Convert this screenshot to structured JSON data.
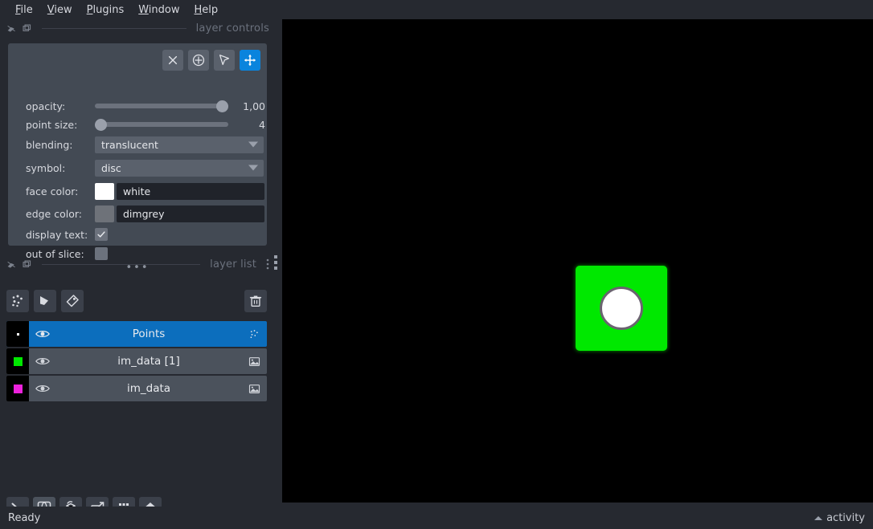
{
  "menubar": {
    "items": [
      {
        "mnemonic": "F",
        "rest": "ile"
      },
      {
        "mnemonic": "V",
        "rest": "iew"
      },
      {
        "mnemonic": "P",
        "rest": "lugins"
      },
      {
        "mnemonic": "W",
        "rest": "indow"
      },
      {
        "mnemonic": "H",
        "rest": "elp"
      }
    ],
    "labels": [
      "File",
      "View",
      "Plugins",
      "Window",
      "Help"
    ]
  },
  "layer_controls": {
    "dock_title": "layer controls",
    "tools": [
      {
        "name": "delete-selected-points",
        "icon": "close-icon",
        "active": false
      },
      {
        "name": "add-points",
        "icon": "add-circle-icon",
        "active": false
      },
      {
        "name": "select-points",
        "icon": "cursor-arrow-icon",
        "active": false
      },
      {
        "name": "pan-zoom",
        "icon": "move-arrows-icon",
        "active": true
      }
    ],
    "opacity": {
      "label": "opacity:",
      "value": "1,00",
      "fraction": 1.0
    },
    "point_size": {
      "label": "point size:",
      "value": "4",
      "fraction": 0.03
    },
    "blending": {
      "label": "blending:",
      "value": "translucent"
    },
    "symbol": {
      "label": "symbol:",
      "value": "disc"
    },
    "face_color": {
      "label": "face color:",
      "value": "white",
      "swatch": "#ffffff"
    },
    "edge_color": {
      "label": "edge color:",
      "value": "dimgrey",
      "swatch": "#6e7279"
    },
    "display_text": {
      "label": "display text:",
      "checked": true
    },
    "out_of_slice": {
      "label": "out of slice:",
      "checked": false
    }
  },
  "layer_list": {
    "dock_title": "layer list",
    "buttons": [
      {
        "name": "new-points-layer",
        "icon": "points-icon"
      },
      {
        "name": "new-shapes-layer",
        "icon": "shapes-icon"
      },
      {
        "name": "new-labels-layer",
        "icon": "labels-tag-icon"
      }
    ],
    "delete_button": {
      "name": "delete-layer",
      "icon": "trash-icon"
    },
    "layers": [
      {
        "name": "Points",
        "type": "points",
        "visible": true,
        "selected": true,
        "thumb_color": "#ffffff",
        "thumb_shape": "dot"
      },
      {
        "name": "im_data [1]",
        "type": "image",
        "visible": true,
        "selected": false,
        "thumb_color": "#00e800",
        "thumb_shape": "square"
      },
      {
        "name": "im_data",
        "type": "image",
        "visible": true,
        "selected": false,
        "thumb_color": "#ee22dd",
        "thumb_shape": "square"
      }
    ]
  },
  "bottom_toolbar": {
    "buttons": [
      {
        "name": "console-button",
        "icon": "terminal-icon",
        "active": false
      },
      {
        "name": "ndisplay-toggle-button",
        "icon": "cube-3d-icon",
        "active": true
      },
      {
        "name": "roll-dims-button",
        "icon": "roll-cube-icon",
        "active": false
      },
      {
        "name": "transpose-dims-button",
        "icon": "transpose-icon",
        "active": false
      },
      {
        "name": "grid-view-button",
        "icon": "grid-icon",
        "active": false
      },
      {
        "name": "home-reset-button",
        "icon": "home-icon",
        "active": false
      }
    ]
  },
  "canvas": {
    "background": "#000000",
    "shapes": [
      {
        "name": "green-image-square",
        "color": "#00e800"
      },
      {
        "name": "white-point-marker",
        "fill": "#ffffff",
        "edge": "#6b6470"
      }
    ]
  },
  "statusbar": {
    "status": "Ready",
    "activity_label": "activity"
  }
}
